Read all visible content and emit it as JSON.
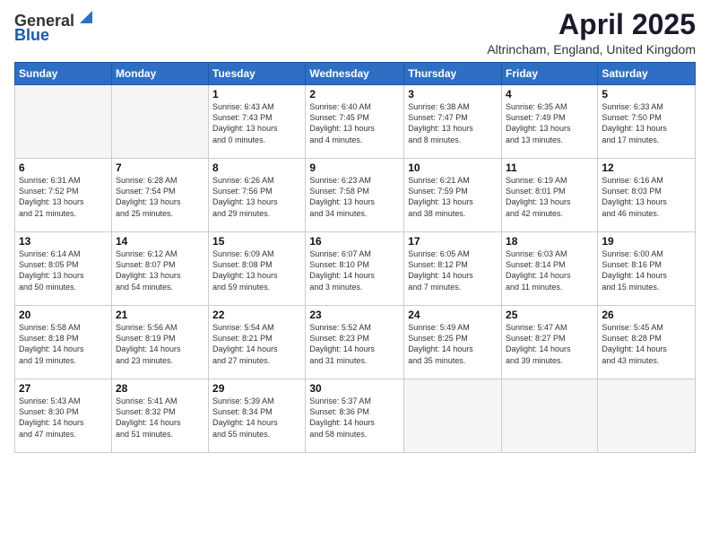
{
  "logo": {
    "general": "General",
    "blue": "Blue"
  },
  "header": {
    "month": "April 2025",
    "location": "Altrincham, England, United Kingdom"
  },
  "weekdays": [
    "Sunday",
    "Monday",
    "Tuesday",
    "Wednesday",
    "Thursday",
    "Friday",
    "Saturday"
  ],
  "weeks": [
    [
      {
        "day": "",
        "info": ""
      },
      {
        "day": "",
        "info": ""
      },
      {
        "day": "1",
        "info": "Sunrise: 6:43 AM\nSunset: 7:43 PM\nDaylight: 13 hours\nand 0 minutes."
      },
      {
        "day": "2",
        "info": "Sunrise: 6:40 AM\nSunset: 7:45 PM\nDaylight: 13 hours\nand 4 minutes."
      },
      {
        "day": "3",
        "info": "Sunrise: 6:38 AM\nSunset: 7:47 PM\nDaylight: 13 hours\nand 8 minutes."
      },
      {
        "day": "4",
        "info": "Sunrise: 6:35 AM\nSunset: 7:49 PM\nDaylight: 13 hours\nand 13 minutes."
      },
      {
        "day": "5",
        "info": "Sunrise: 6:33 AM\nSunset: 7:50 PM\nDaylight: 13 hours\nand 17 minutes."
      }
    ],
    [
      {
        "day": "6",
        "info": "Sunrise: 6:31 AM\nSunset: 7:52 PM\nDaylight: 13 hours\nand 21 minutes."
      },
      {
        "day": "7",
        "info": "Sunrise: 6:28 AM\nSunset: 7:54 PM\nDaylight: 13 hours\nand 25 minutes."
      },
      {
        "day": "8",
        "info": "Sunrise: 6:26 AM\nSunset: 7:56 PM\nDaylight: 13 hours\nand 29 minutes."
      },
      {
        "day": "9",
        "info": "Sunrise: 6:23 AM\nSunset: 7:58 PM\nDaylight: 13 hours\nand 34 minutes."
      },
      {
        "day": "10",
        "info": "Sunrise: 6:21 AM\nSunset: 7:59 PM\nDaylight: 13 hours\nand 38 minutes."
      },
      {
        "day": "11",
        "info": "Sunrise: 6:19 AM\nSunset: 8:01 PM\nDaylight: 13 hours\nand 42 minutes."
      },
      {
        "day": "12",
        "info": "Sunrise: 6:16 AM\nSunset: 8:03 PM\nDaylight: 13 hours\nand 46 minutes."
      }
    ],
    [
      {
        "day": "13",
        "info": "Sunrise: 6:14 AM\nSunset: 8:05 PM\nDaylight: 13 hours\nand 50 minutes."
      },
      {
        "day": "14",
        "info": "Sunrise: 6:12 AM\nSunset: 8:07 PM\nDaylight: 13 hours\nand 54 minutes."
      },
      {
        "day": "15",
        "info": "Sunrise: 6:09 AM\nSunset: 8:08 PM\nDaylight: 13 hours\nand 59 minutes."
      },
      {
        "day": "16",
        "info": "Sunrise: 6:07 AM\nSunset: 8:10 PM\nDaylight: 14 hours\nand 3 minutes."
      },
      {
        "day": "17",
        "info": "Sunrise: 6:05 AM\nSunset: 8:12 PM\nDaylight: 14 hours\nand 7 minutes."
      },
      {
        "day": "18",
        "info": "Sunrise: 6:03 AM\nSunset: 8:14 PM\nDaylight: 14 hours\nand 11 minutes."
      },
      {
        "day": "19",
        "info": "Sunrise: 6:00 AM\nSunset: 8:16 PM\nDaylight: 14 hours\nand 15 minutes."
      }
    ],
    [
      {
        "day": "20",
        "info": "Sunrise: 5:58 AM\nSunset: 8:18 PM\nDaylight: 14 hours\nand 19 minutes."
      },
      {
        "day": "21",
        "info": "Sunrise: 5:56 AM\nSunset: 8:19 PM\nDaylight: 14 hours\nand 23 minutes."
      },
      {
        "day": "22",
        "info": "Sunrise: 5:54 AM\nSunset: 8:21 PM\nDaylight: 14 hours\nand 27 minutes."
      },
      {
        "day": "23",
        "info": "Sunrise: 5:52 AM\nSunset: 8:23 PM\nDaylight: 14 hours\nand 31 minutes."
      },
      {
        "day": "24",
        "info": "Sunrise: 5:49 AM\nSunset: 8:25 PM\nDaylight: 14 hours\nand 35 minutes."
      },
      {
        "day": "25",
        "info": "Sunrise: 5:47 AM\nSunset: 8:27 PM\nDaylight: 14 hours\nand 39 minutes."
      },
      {
        "day": "26",
        "info": "Sunrise: 5:45 AM\nSunset: 8:28 PM\nDaylight: 14 hours\nand 43 minutes."
      }
    ],
    [
      {
        "day": "27",
        "info": "Sunrise: 5:43 AM\nSunset: 8:30 PM\nDaylight: 14 hours\nand 47 minutes."
      },
      {
        "day": "28",
        "info": "Sunrise: 5:41 AM\nSunset: 8:32 PM\nDaylight: 14 hours\nand 51 minutes."
      },
      {
        "day": "29",
        "info": "Sunrise: 5:39 AM\nSunset: 8:34 PM\nDaylight: 14 hours\nand 55 minutes."
      },
      {
        "day": "30",
        "info": "Sunrise: 5:37 AM\nSunset: 8:36 PM\nDaylight: 14 hours\nand 58 minutes."
      },
      {
        "day": "",
        "info": ""
      },
      {
        "day": "",
        "info": ""
      },
      {
        "day": "",
        "info": ""
      }
    ]
  ]
}
